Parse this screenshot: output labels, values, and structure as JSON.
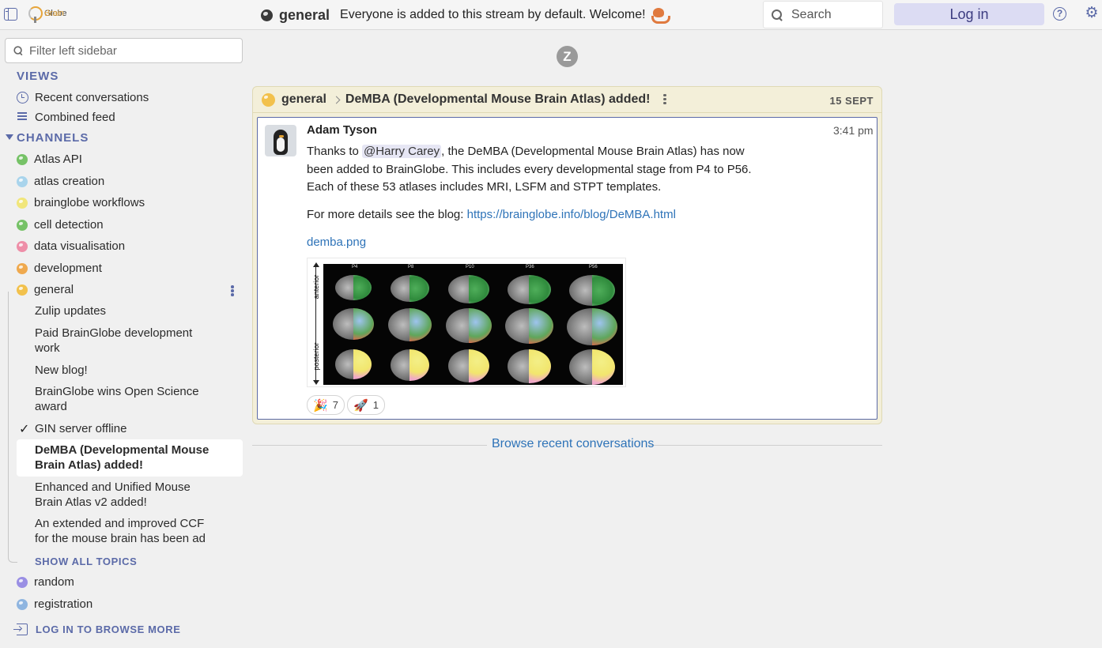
{
  "topbar": {
    "logo_prefix": "Brain",
    "logo_suffix": "Globe",
    "stream_name": "general",
    "stream_description": "Everyone is added to this stream by default. Welcome!",
    "search_placeholder": "Search",
    "login_label": "Log in",
    "help_glyph": "?",
    "settings_glyph": "⚙"
  },
  "sidebar": {
    "filter_placeholder": "Filter left sidebar",
    "views_header": "VIEWS",
    "views": [
      {
        "label": "Recent conversations",
        "icon": "clock-icon"
      },
      {
        "label": "Combined feed",
        "icon": "feed-icon"
      }
    ],
    "channels_header": "CHANNELS",
    "channels": [
      {
        "label": "Atlas API",
        "color": "#76c267"
      },
      {
        "label": "atlas creation",
        "color": "#a9d4ec"
      },
      {
        "label": "brainglobe workflows",
        "color": "#f1e67b"
      },
      {
        "label": "cell detection",
        "color": "#76c267"
      },
      {
        "label": "data visualisation",
        "color": "#ee8ea8"
      },
      {
        "label": "development",
        "color": "#efa94e"
      },
      {
        "label": "general",
        "color": "#f2c14c"
      },
      {
        "label": "random",
        "color": "#9a8fe4"
      },
      {
        "label": "registration",
        "color": "#8fb5e0"
      }
    ],
    "topics": [
      "Zulip updates",
      "Paid BrainGlobe development work",
      "New blog!",
      "BrainGlobe wins Open Science award",
      "GIN server offline",
      "DeMBA (Developmental Mouse Brain Atlas) added!",
      "Enhanced and Unified Mouse Brain Atlas v2 added!",
      "An extended and improved CCF for the mouse brain has been ad"
    ],
    "check_glyph": "✓",
    "show_all_topics": "SHOW ALL TOPICS",
    "login_more": "LOG IN TO BROWSE MORE"
  },
  "message": {
    "z_glyph": "Z",
    "stream": "general",
    "topic": "DeMBA (Developmental Mouse Brain Atlas) added!",
    "date": "15 SEPT",
    "sender": "Adam Tyson",
    "time": "3:41 pm",
    "text_before_mention": "Thanks to ",
    "mention": "@Harry Carey",
    "text_after_mention": ", the DeMBA (Developmental Mouse Brain Atlas) has now been added to BrainGlobe. This includes every developmental stage from P4 to P56. Each of these 53 atlases includes MRI, LSFM and STPT templates.",
    "blog_prefix": "For more details see the blog: ",
    "blog_link": "https://brainglobe.info/blog/DeMBA.html",
    "attachment": "demba.png",
    "image": {
      "ages": [
        "P4",
        "P8",
        "P10",
        "P36",
        "P56"
      ],
      "axis_top": "anterior",
      "axis_bottom": "posterior"
    },
    "reactions": [
      {
        "emoji": "🎉",
        "count": "7"
      },
      {
        "emoji": "🚀",
        "count": "1"
      }
    ]
  },
  "footer": {
    "browse_recent": "Browse recent conversations"
  },
  "colors": {
    "accent": "#5b6aa8",
    "link": "#2e73b8",
    "recipient_bar": "#f3efd9",
    "login_bg": "#dcdcf3"
  }
}
